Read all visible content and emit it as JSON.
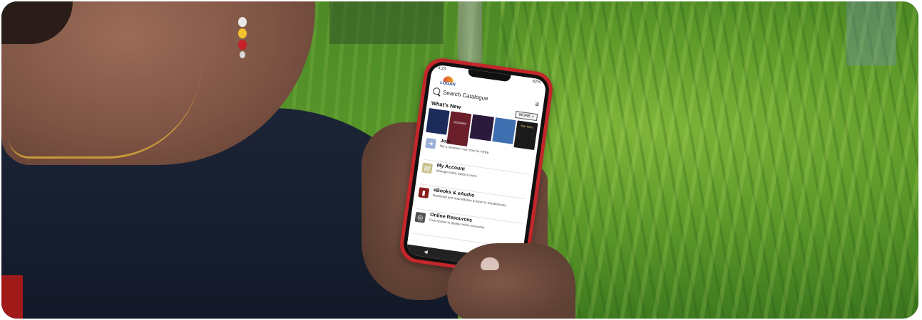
{
  "scene": {
    "description_colors": {
      "grass": "#5e9a2a",
      "shirt": "#1b2436",
      "phone_case": "#c3262b"
    }
  },
  "phone_app": {
    "status_time": "4:23",
    "status_battery": "82%",
    "logo_text": "LOGAN",
    "search_label": "Search Catalogue",
    "whats_new_label": "What's New",
    "more_button_label": "MORE »",
    "covers": [
      {
        "color": "#1c2b5a",
        "text": ""
      },
      {
        "color": "#6a1f2a",
        "text": "DOGMAN"
      },
      {
        "color": "#2b1a3c",
        "text": ""
      },
      {
        "color": "#3f6fb0",
        "text": ""
      },
      {
        "color": "#1a1a1a",
        "text": "Star Wars"
      }
    ],
    "menu": [
      {
        "icon": "join-arrow-icon",
        "icon_color": "#9ab0d6",
        "title": "Join",
        "subtitle": "Not a member? Join now for FREE"
      },
      {
        "icon": "id-card-icon",
        "icon_color": "#c9c08a",
        "title": "My Account",
        "subtitle": "Manage loans, holds & more"
      },
      {
        "icon": "ebook-icon",
        "icon_color": "#8a1c1c",
        "title": "eBooks & eAudio",
        "subtitle": "Download and read eBooks & listen to eAudiobooks"
      },
      {
        "icon": "globe-icon",
        "icon_color": "#555555",
        "title": "Online Resources",
        "subtitle": "Free access to quality online resources"
      }
    ],
    "nav": {
      "back": "◀",
      "home": "●",
      "recent": "■"
    }
  }
}
